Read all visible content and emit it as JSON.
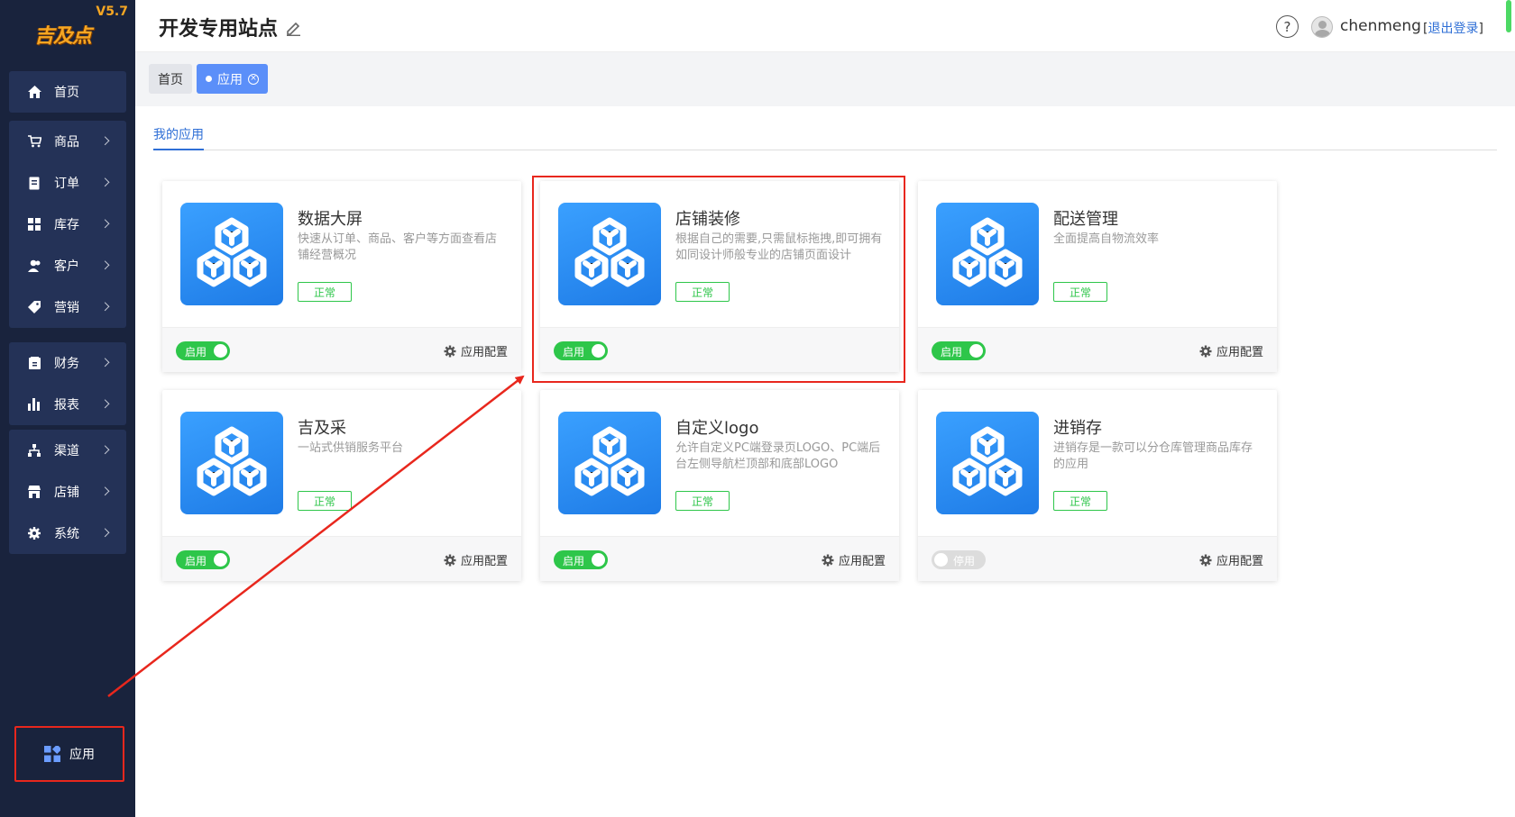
{
  "sidebar": {
    "logo": "吉及点",
    "version": "V5.7",
    "groups": [
      [
        {
          "label": "首页",
          "icon": "home-icon"
        }
      ],
      [
        {
          "label": "商品",
          "icon": "cart-icon"
        },
        {
          "label": "订单",
          "icon": "order-icon"
        },
        {
          "label": "库存",
          "icon": "inventory-icon"
        },
        {
          "label": "客户",
          "icon": "customer-icon"
        },
        {
          "label": "营销",
          "icon": "tag-icon"
        }
      ],
      [
        {
          "label": "财务",
          "icon": "finance-icon"
        },
        {
          "label": "报表",
          "icon": "report-icon"
        }
      ],
      [
        {
          "label": "渠道",
          "icon": "channel-icon"
        },
        {
          "label": "店铺",
          "icon": "store-icon"
        },
        {
          "label": "系统",
          "icon": "settings-icon"
        }
      ]
    ],
    "apps_label": "应用"
  },
  "header": {
    "site_title": "开发专用站点",
    "username": "chenmeng",
    "logout": "退出登录"
  },
  "tabs": [
    {
      "label": "首页"
    },
    {
      "label": "应用",
      "active": true
    }
  ],
  "subtab": {
    "label": "我的应用"
  },
  "cards": [
    {
      "name": "数据大屏",
      "desc": "快速从订单、商品、客户等方面查看店铺经营概况",
      "status": "正常",
      "toggle": "启用",
      "enabled": true,
      "config": "应用配置"
    },
    {
      "name": "店铺装修",
      "desc": "根据自己的需要,只需鼠标拖拽,即可拥有如同设计师般专业的店铺页面设计",
      "status": "正常",
      "toggle": "启用",
      "enabled": true,
      "config": ""
    },
    {
      "name": "配送管理",
      "desc": "全面提高自物流效率",
      "status": "正常",
      "toggle": "启用",
      "enabled": true,
      "config": "应用配置"
    },
    {
      "name": "吉及采",
      "desc": "一站式供销服务平台",
      "status": "正常",
      "toggle": "启用",
      "enabled": true,
      "config": "应用配置"
    },
    {
      "name": "自定义logo",
      "desc": "允许自定义PC端登录页LOGO、PC端后台左侧导航栏顶部和底部LOGO",
      "status": "正常",
      "toggle": "启用",
      "enabled": true,
      "config": "应用配置"
    },
    {
      "name": "进销存",
      "desc": "进销存是一款可以分仓库管理商品库存的应用",
      "status": "正常",
      "toggle": "停用",
      "enabled": false,
      "config": "应用配置"
    }
  ],
  "colors": {
    "sidebar_bg": "#19233d",
    "nav_group_bg": "#243257",
    "accent": "#2f6fd6",
    "tab_active": "#5b8ff9",
    "success": "#2ec64a",
    "annotation": "#e8271d"
  }
}
